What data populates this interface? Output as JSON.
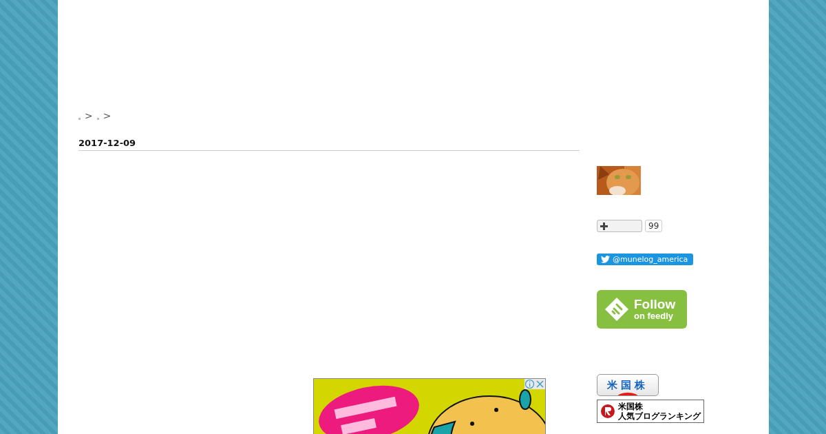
{
  "breadcrumb": [
    {
      "separator": ">"
    },
    {
      "separator": ">"
    }
  ],
  "post": {
    "date": "2017-12-09"
  },
  "sidebar": {
    "follow_count": "99",
    "twitter": "@munelog_america",
    "feedly": {
      "title": "Follow",
      "subtitle": "on feedly"
    },
    "banners": [
      {
        "kind": "flag",
        "title": "米国株"
      },
      {
        "kind": "ranking",
        "title": "米国株",
        "subtitle": "人気ブログランキング"
      }
    ]
  }
}
